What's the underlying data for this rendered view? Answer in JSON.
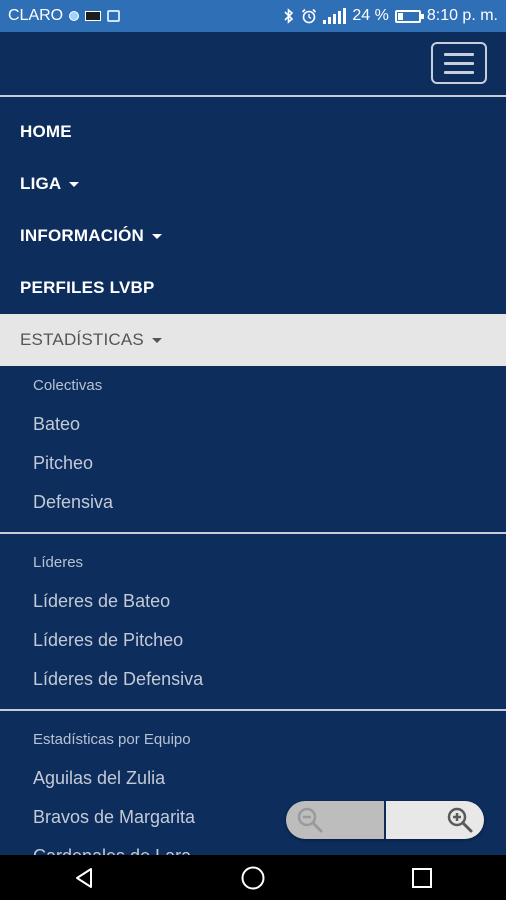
{
  "status_bar": {
    "carrier": "CLARO",
    "battery_percent": "24 %",
    "battery_level": 0.24,
    "time": "8:10 p. m.",
    "icons": [
      "notification-dot-icon",
      "sim-icon",
      "image-icon",
      "bluetooth-icon",
      "alarm-icon",
      "signal-icon",
      "battery-icon"
    ]
  },
  "header": {
    "menu_button_icon": "hamburger-menu-icon"
  },
  "nav": {
    "items": [
      {
        "label": "HOME",
        "has_caret": false
      },
      {
        "label": "LIGA",
        "has_caret": true
      },
      {
        "label": "INFORMACIÓN",
        "has_caret": true
      },
      {
        "label": "PERFILES LVBP",
        "has_caret": false
      },
      {
        "label": "ESTADÍSTICAS",
        "has_caret": true,
        "active": true
      }
    ]
  },
  "dropdown": {
    "groups": [
      {
        "header": "Colectivas",
        "items": [
          "Bateo",
          "Pitcheo",
          "Defensiva"
        ]
      },
      {
        "header": "Líderes",
        "items": [
          "Líderes de Bateo",
          "Líderes de Pitcheo",
          "Líderes de Defensiva"
        ]
      },
      {
        "header": "Estadísticas por Equipo",
        "items": [
          "Aguilas del Zulia",
          "Bravos de Margarita",
          "Cardenales de Lara"
        ]
      }
    ]
  },
  "zoom": {
    "out_icon": "zoom-out-icon",
    "in_icon": "zoom-in-icon"
  },
  "navigation_bar": {
    "icons": [
      "back-icon",
      "home-icon",
      "recents-icon"
    ]
  },
  "colors": {
    "background": "#0d2d5c",
    "status_bar": "#2f6fb6",
    "active_item_bg": "#e6e6e6",
    "divider": "#c9cbd6"
  }
}
